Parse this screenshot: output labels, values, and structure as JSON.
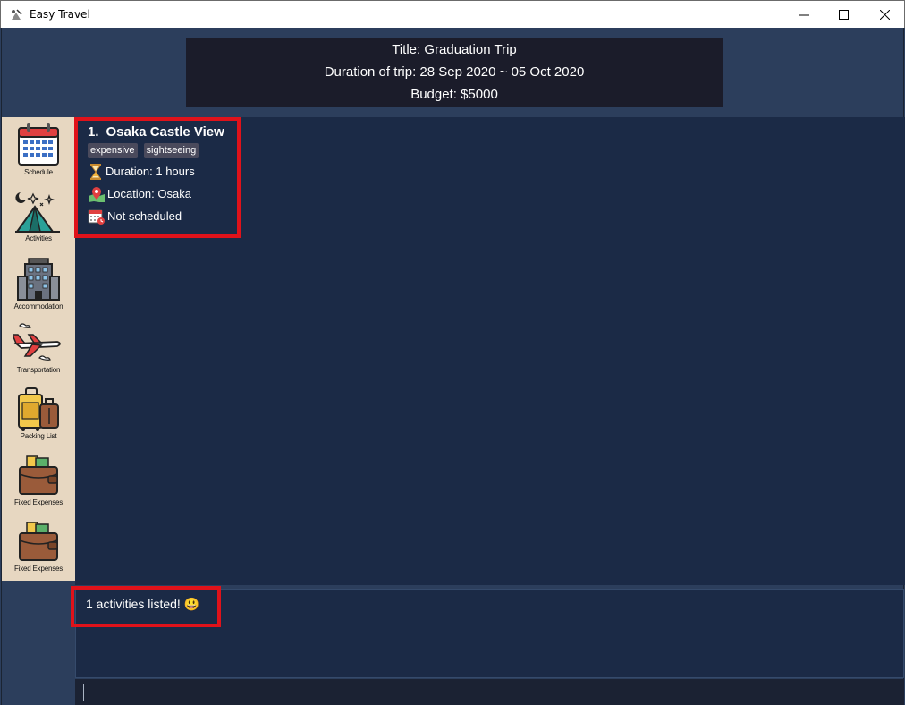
{
  "window": {
    "title": "Easy Travel"
  },
  "trip": {
    "title": "Title: Graduation Trip",
    "duration": "Duration of trip: 28 Sep 2020 ~ 05 Oct 2020",
    "budget": "Budget: $5000"
  },
  "sidebar": {
    "items": [
      {
        "label": "Schedule",
        "icon": "calendar-icon"
      },
      {
        "label": "Activities",
        "icon": "tent-icon"
      },
      {
        "label": "Accommodation",
        "icon": "hotel-icon"
      },
      {
        "label": "Transportation",
        "icon": "airplane-icon"
      },
      {
        "label": "Packing List",
        "icon": "luggage-icon"
      },
      {
        "label": "Fixed Expenses",
        "icon": "wallet-icon"
      },
      {
        "label": "Fixed Expenses",
        "icon": "wallet-icon"
      }
    ]
  },
  "activities": [
    {
      "index": "1.",
      "name": "Osaka Castle View",
      "tags": [
        "expensive",
        "sightseeing"
      ],
      "duration": "Duration: 1 hours",
      "location": "Location: Osaka",
      "schedule": "Not scheduled"
    }
  ],
  "result": {
    "message": "1 activities listed! 😃"
  },
  "command": {
    "value": ""
  },
  "colors": {
    "highlight": "#e0121a",
    "panel": "#1b2a46",
    "sidebar": "#e7d7c1"
  }
}
